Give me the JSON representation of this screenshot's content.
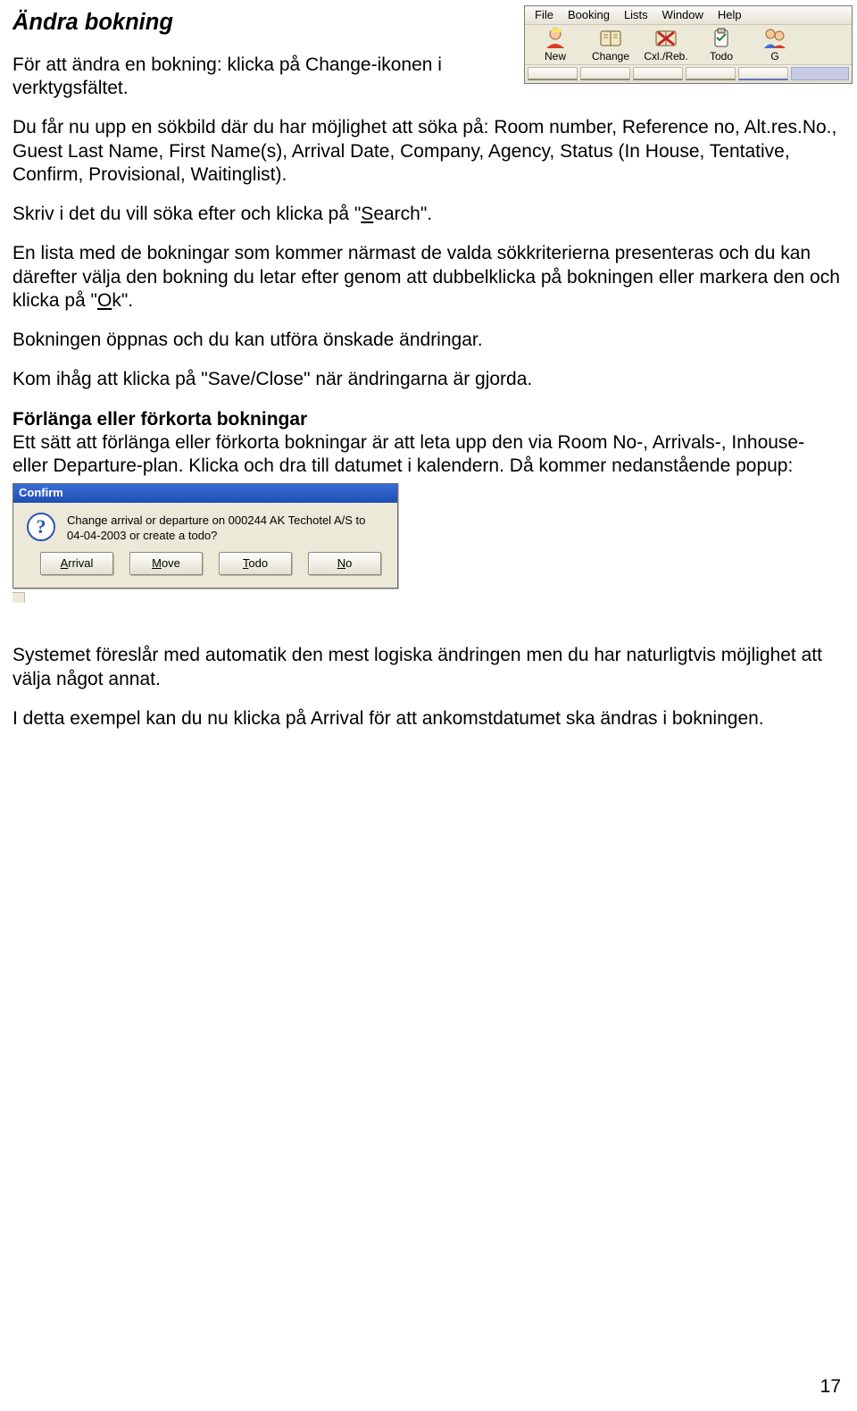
{
  "title": "Ändra bokning",
  "p1a": "För att ändra en bokning: klicka på Change-ikonen i",
  "p1b": "verktygsfältet.",
  "p2": "Du får nu upp en sökbild där du har möjlighet att söka på: Room number, Reference no, Alt.res.No., Guest Last Name, First Name(s), Arrival Date, Company, Agency, Status (In House, Tentative, Confirm, Provisional, Waitinglist).",
  "p3a": "Skriv i det du vill söka efter och klicka på \"",
  "p3u": "S",
  "p3b": "earch\".",
  "p4a": "En lista med de bokningar som kommer närmast de valda sökkriterierna presenteras och du kan därefter välja den bokning du letar efter genom att dubbelklicka på bokningen eller markera den och klicka på \"",
  "p4u": "O",
  "p4b": "k\".",
  "p5": "Bokningen öppnas och du kan utföra önskade ändringar.",
  "p6": "Kom ihåg att klicka på \"Save/Close\" när ändringarna är gjorda.",
  "sub1": "Förlänga eller förkorta bokningar",
  "p7": "Ett sätt att förlänga eller förkorta bokningar är att leta upp den via Room No-, Arrivals-, Inhouse- eller Departure-plan. Klicka och dra till datumet i kalendern. Då kommer nedanstående popup:",
  "p8": "Systemet föreslår med automatik den mest logiska ändringen men du har naturligtvis möjlighet att välja något annat.",
  "p9": "I detta exempel kan du nu klicka på Arrival för att ankomstdatumet ska ändras i bokningen.",
  "page_number": "17",
  "menubar": [
    "File",
    "Booking",
    "Lists",
    "Window",
    "Help"
  ],
  "toolbar": {
    "items": [
      "New",
      "Change",
      "Cxl./Reb.",
      "Todo",
      "G"
    ]
  },
  "confirm": {
    "title": "Confirm",
    "msg1": "Change arrival or departure on 000244 AK Techotel A/S to",
    "msg2": "04-04-2003 or create a todo?",
    "buttons": [
      {
        "mn": "A",
        "rest": "rrival"
      },
      {
        "mn": "M",
        "rest": "ove"
      },
      {
        "mn": "T",
        "rest": "odo"
      },
      {
        "mn": "N",
        "rest": "o"
      }
    ]
  }
}
